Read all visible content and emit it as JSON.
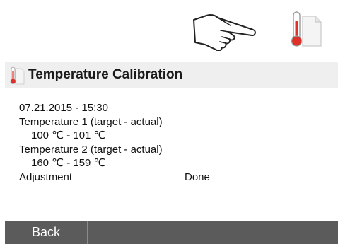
{
  "window": {
    "title": "Temperature Calibration"
  },
  "icons": {
    "top_hand": "pointing-hand-icon",
    "top_thermometer": "thermometer-icon",
    "title_thermometer": "thermometer-icon"
  },
  "result": {
    "timestamp": "07.21.2015 - 15:30",
    "temp1_label": "Temperature 1 (target - actual)",
    "temp1_value": "100 ℃ - 101 ℃",
    "temp2_label": "Temperature 2 (target - actual)",
    "temp2_value": "160 ℃ - 159 ℃",
    "adjustment_label": "Adjustment",
    "adjustment_value": "Done"
  },
  "footer": {
    "back_label": "Back"
  },
  "colors": {
    "title_bar": "#efefef",
    "footer_bar": "#5b5b5b",
    "thermometer_red": "#e0302a"
  }
}
